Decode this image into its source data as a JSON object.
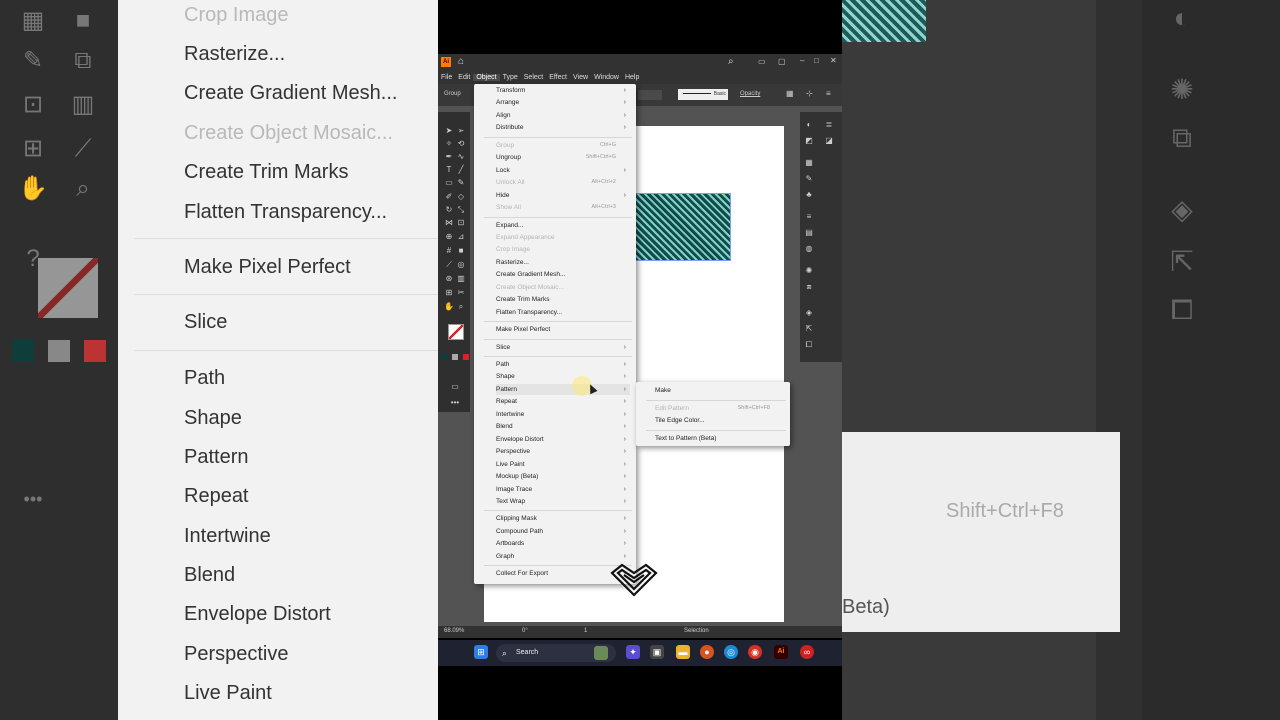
{
  "background_left_menu": {
    "items": [
      {
        "label": "Crop Image",
        "disabled": true
      },
      {
        "label": "Rasterize...",
        "disabled": false
      },
      {
        "label": "Create Gradient Mesh...",
        "disabled": false
      },
      {
        "label": "Create Object Mosaic...",
        "disabled": true
      },
      {
        "label": "Create Trim Marks",
        "disabled": false
      },
      {
        "label": "Flatten Transparency...",
        "disabled": false
      },
      {
        "label": "Make Pixel Perfect",
        "disabled": false
      },
      {
        "label": "Slice",
        "disabled": false
      },
      {
        "label": "Path",
        "disabled": false
      },
      {
        "label": "Shape",
        "disabled": false
      },
      {
        "label": "Pattern",
        "disabled": false
      },
      {
        "label": "Repeat",
        "disabled": false
      },
      {
        "label": "Intertwine",
        "disabled": false
      },
      {
        "label": "Blend",
        "disabled": false
      },
      {
        "label": "Envelope Distort",
        "disabled": false
      },
      {
        "label": "Perspective",
        "disabled": false
      },
      {
        "label": "Live Paint",
        "disabled": false
      }
    ]
  },
  "background_right_submenu": {
    "shortcut": "Shift+Ctrl+F8",
    "beta": "Beta)"
  },
  "app": {
    "logo": "Ai",
    "menubar": [
      "File",
      "Edit",
      "Object",
      "Type",
      "Select",
      "Effect",
      "View",
      "Window",
      "Help"
    ],
    "active_menu": "Object",
    "control": {
      "selection_type": "Group",
      "stroke_style": "Basic",
      "opacity_label": "Opacity"
    },
    "status": {
      "zoom": "68.09%",
      "rotation": "0°",
      "artboard": "1",
      "tool": "Selection"
    },
    "taskbar": {
      "search_placeholder": "Search"
    }
  },
  "object_menu": {
    "items": [
      {
        "label": "Transform",
        "shortcut": "",
        "submenu": true,
        "disabled": false
      },
      {
        "label": "Arrange",
        "shortcut": "",
        "submenu": true,
        "disabled": false
      },
      {
        "label": "Align",
        "shortcut": "",
        "submenu": true,
        "disabled": false
      },
      {
        "label": "Distribute",
        "shortcut": "",
        "submenu": true,
        "disabled": false
      },
      {
        "sep": true
      },
      {
        "label": "Group",
        "shortcut": "Ctrl+G",
        "submenu": false,
        "disabled": true
      },
      {
        "label": "Ungroup",
        "shortcut": "Shift+Ctrl+G",
        "submenu": false,
        "disabled": false
      },
      {
        "label": "Lock",
        "shortcut": "",
        "submenu": true,
        "disabled": false
      },
      {
        "label": "Unlock All",
        "shortcut": "Alt+Ctrl+2",
        "submenu": false,
        "disabled": true
      },
      {
        "label": "Hide",
        "shortcut": "",
        "submenu": true,
        "disabled": false
      },
      {
        "label": "Show All",
        "shortcut": "Alt+Ctrl+3",
        "submenu": false,
        "disabled": true
      },
      {
        "sep": true
      },
      {
        "label": "Expand...",
        "shortcut": "",
        "submenu": false,
        "disabled": false
      },
      {
        "label": "Expand Appearance",
        "shortcut": "",
        "submenu": false,
        "disabled": true
      },
      {
        "label": "Crop Image",
        "shortcut": "",
        "submenu": false,
        "disabled": true
      },
      {
        "label": "Rasterize...",
        "shortcut": "",
        "submenu": false,
        "disabled": false
      },
      {
        "label": "Create Gradient Mesh...",
        "shortcut": "",
        "submenu": false,
        "disabled": false
      },
      {
        "label": "Create Object Mosaic...",
        "shortcut": "",
        "submenu": false,
        "disabled": true
      },
      {
        "label": "Create Trim Marks",
        "shortcut": "",
        "submenu": false,
        "disabled": false
      },
      {
        "label": "Flatten Transparency...",
        "shortcut": "",
        "submenu": false,
        "disabled": false
      },
      {
        "sep": true
      },
      {
        "label": "Make Pixel Perfect",
        "shortcut": "",
        "submenu": false,
        "disabled": false
      },
      {
        "sep": true
      },
      {
        "label": "Slice",
        "shortcut": "",
        "submenu": true,
        "disabled": false
      },
      {
        "sep": true
      },
      {
        "label": "Path",
        "shortcut": "",
        "submenu": true,
        "disabled": false
      },
      {
        "label": "Shape",
        "shortcut": "",
        "submenu": true,
        "disabled": false
      },
      {
        "label": "Pattern",
        "shortcut": "",
        "submenu": true,
        "disabled": false,
        "highlight": true
      },
      {
        "label": "Repeat",
        "shortcut": "",
        "submenu": true,
        "disabled": false
      },
      {
        "label": "Intertwine",
        "shortcut": "",
        "submenu": true,
        "disabled": false
      },
      {
        "label": "Blend",
        "shortcut": "",
        "submenu": true,
        "disabled": false
      },
      {
        "label": "Envelope Distort",
        "shortcut": "",
        "submenu": true,
        "disabled": false
      },
      {
        "label": "Perspective",
        "shortcut": "",
        "submenu": true,
        "disabled": false
      },
      {
        "label": "Live Paint",
        "shortcut": "",
        "submenu": true,
        "disabled": false
      },
      {
        "label": "Mockup (Beta)",
        "shortcut": "",
        "submenu": true,
        "disabled": false
      },
      {
        "label": "Image Trace",
        "shortcut": "",
        "submenu": true,
        "disabled": false
      },
      {
        "label": "Text Wrap",
        "shortcut": "",
        "submenu": true,
        "disabled": false
      },
      {
        "sep": true
      },
      {
        "label": "Clipping Mask",
        "shortcut": "",
        "submenu": true,
        "disabled": false
      },
      {
        "label": "Compound Path",
        "shortcut": "",
        "submenu": true,
        "disabled": false
      },
      {
        "label": "Artboards",
        "shortcut": "",
        "submenu": true,
        "disabled": false
      },
      {
        "label": "Graph",
        "shortcut": "",
        "submenu": true,
        "disabled": false
      },
      {
        "sep": true
      },
      {
        "label": "Collect For Export",
        "shortcut": "",
        "submenu": true,
        "disabled": false
      }
    ]
  },
  "pattern_submenu": {
    "items": [
      {
        "label": "Make",
        "shortcut": "",
        "disabled": false
      },
      {
        "sep": true
      },
      {
        "label": "Edit Pattern",
        "shortcut": "Shift+Ctrl+F8",
        "disabled": true
      },
      {
        "label": "Tile Edge Color...",
        "shortcut": "",
        "disabled": false
      },
      {
        "sep": true
      },
      {
        "label": "Text to Pattern (Beta)",
        "shortcut": "",
        "disabled": false
      }
    ]
  },
  "colors": {
    "menu_bg": "#f2f2f2",
    "app_dark": "#323232",
    "pattern_teal": "#7fd2c8"
  }
}
